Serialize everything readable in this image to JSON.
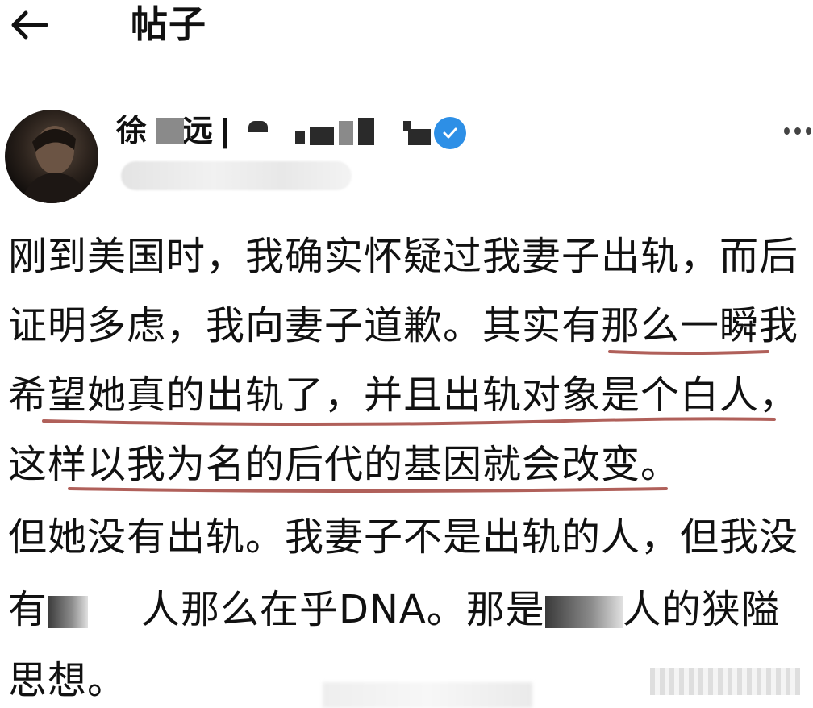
{
  "header": {
    "title": "帖子",
    "back_icon": "arrow-left-icon"
  },
  "author": {
    "name_first": "徐",
    "name_last": "远",
    "name_separator": "|",
    "verified_icon": "verified-badge-icon",
    "more_icon": "more-dots-icon"
  },
  "post": {
    "lines": [
      "刚到美国时，我确实怀疑过我妻子出轨，而后",
      "证明多虑，我向妻子道歉。其实有那么一瞬我",
      "希望她真的出轨了，并且出轨对象是个白人，",
      "这样以我为名的后代的基因就会改变。",
      "但她没有出轨。我妻子不是出轨的人，但我没"
    ],
    "line6_a": "有",
    "line6_b": "人那么在乎DNA。那是",
    "line6_c": "人的狭隘",
    "line7": "思想。"
  },
  "colors": {
    "underline": "#b0605a",
    "verified": "#2d8fe6",
    "text": "#111111"
  }
}
